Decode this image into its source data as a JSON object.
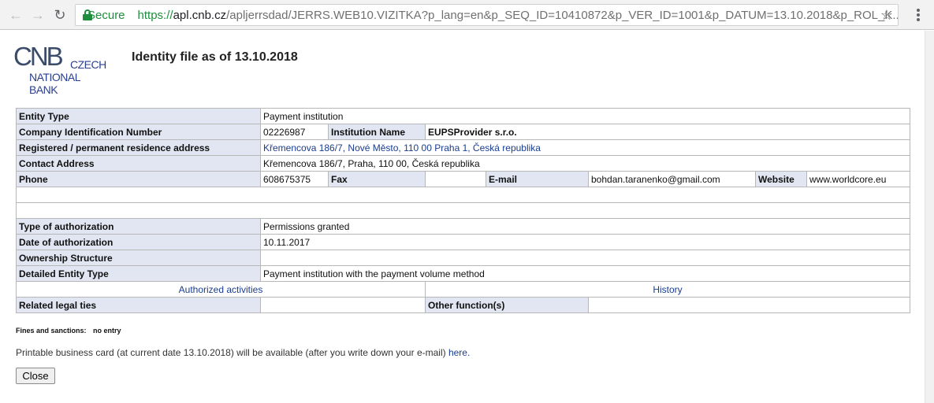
{
  "browser": {
    "secure_label": "Secure",
    "url_scheme": "https://",
    "url_host": "apl.cnb.cz",
    "url_rest": "/apljerrsdad/JERRS.WEB10.VIZITKA?p_lang=en&p_SEQ_ID=10410872&p_VER_ID=1001&p_DATUM=13.10.2018&p_ROL_K..."
  },
  "logo": {
    "cnb": "CNB",
    "line1": "CZECH",
    "line2": "NATIONAL",
    "line3": "BANK"
  },
  "page_title": "Identity file as of 13.10.2018",
  "fields": {
    "entity_type_label": "Entity Type",
    "entity_type_value": "Payment institution",
    "company_id_label": "Company Identification Number",
    "company_id_value": "02226987",
    "institution_name_label": "Institution Name",
    "institution_name_value": "EUPSProvider s.r.o.",
    "address_label": "Registered / permanent residence address",
    "address_value": "Křemencova 186/7, Nové Město, 110 00 Praha 1, Česká republika",
    "contact_label": "Contact Address",
    "contact_value": "Křemencova 186/7, Praha, 110 00, Česká republika",
    "phone_label": "Phone",
    "phone_value": "608675375",
    "fax_label": "Fax",
    "fax_value": "",
    "email_label": "E-mail",
    "email_value": "bohdan.taranenko@gmail.com",
    "website_label": "Website",
    "website_value": "www.worldcore.eu",
    "auth_type_label": "Type of authorization",
    "auth_type_value": "Permissions granted",
    "auth_date_label": "Date of authorization",
    "auth_date_value": "10.11.2017",
    "ownership_label": "Ownership Structure",
    "ownership_value": "",
    "detailed_type_label": "Detailed Entity Type",
    "detailed_type_value": "Payment institution with the payment volume method",
    "authorized_activities_link": "Authorized activities",
    "history_link": "History",
    "related_ties_label": "Related legal ties",
    "related_ties_value": "",
    "other_functions_label": "Other function(s)",
    "other_functions_value": ""
  },
  "fines": {
    "label": "Fines and sanctions:",
    "value": "no entry"
  },
  "printable": {
    "text": "Printable business card (at current date 13.10.2018) will be available (after you write down your e-mail)",
    "link": "here."
  },
  "close_button": "Close"
}
